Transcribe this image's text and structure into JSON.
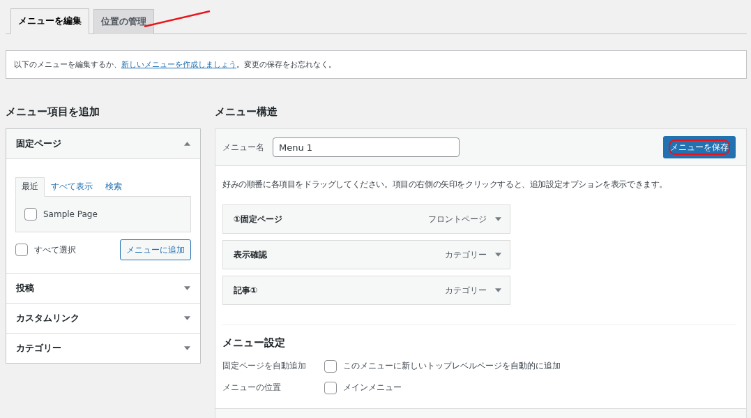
{
  "tabs": [
    {
      "label": "メニューを編集",
      "selected": true
    },
    {
      "label": "位置の管理",
      "selected": false
    }
  ],
  "notice": {
    "before": "以下のメニューを編集するか、",
    "link": "新しいメニューを作成しましょう",
    "after": "。変更の保存をお忘れなく。"
  },
  "add_items": {
    "heading": "メニュー項目を追加",
    "sections": [
      {
        "title": "固定ページ",
        "expanded": true,
        "tabs": [
          {
            "label": "最近",
            "selected": true
          },
          {
            "label": "すべて表示",
            "selected": false
          },
          {
            "label": "検索",
            "selected": false
          }
        ],
        "items": [
          {
            "label": "Sample Page",
            "checked": false
          }
        ],
        "select_all": {
          "label": "すべて選択",
          "checked": false
        },
        "button": "メニューに追加"
      },
      {
        "title": "投稿",
        "expanded": false
      },
      {
        "title": "カスタムリンク",
        "expanded": false
      },
      {
        "title": "カテゴリー",
        "expanded": false
      }
    ]
  },
  "structure": {
    "heading": "メニュー構造",
    "name_label": "メニュー名",
    "name_value": "Menu 1",
    "save_button": "メニューを保存",
    "instructions": "好みの順番に各項目をドラッグしてください。項目の右側の矢印をクリックすると、追加設定オプションを表示できます。",
    "items": [
      {
        "title": "①固定ページ",
        "type": "フロントページ"
      },
      {
        "title": "表示確認",
        "type": "カテゴリー"
      },
      {
        "title": "記事①",
        "type": "カテゴリー"
      }
    ],
    "settings": {
      "heading": "メニュー設定",
      "rows": [
        {
          "label": "固定ページを自動追加",
          "option": "このメニューに新しいトップレベルページを自動的に追加",
          "checked": false
        },
        {
          "label": "メニューの位置",
          "option": "メインメニュー",
          "checked": false
        }
      ]
    }
  },
  "annotations": {
    "tab_stroke": true,
    "save_ring": true
  }
}
